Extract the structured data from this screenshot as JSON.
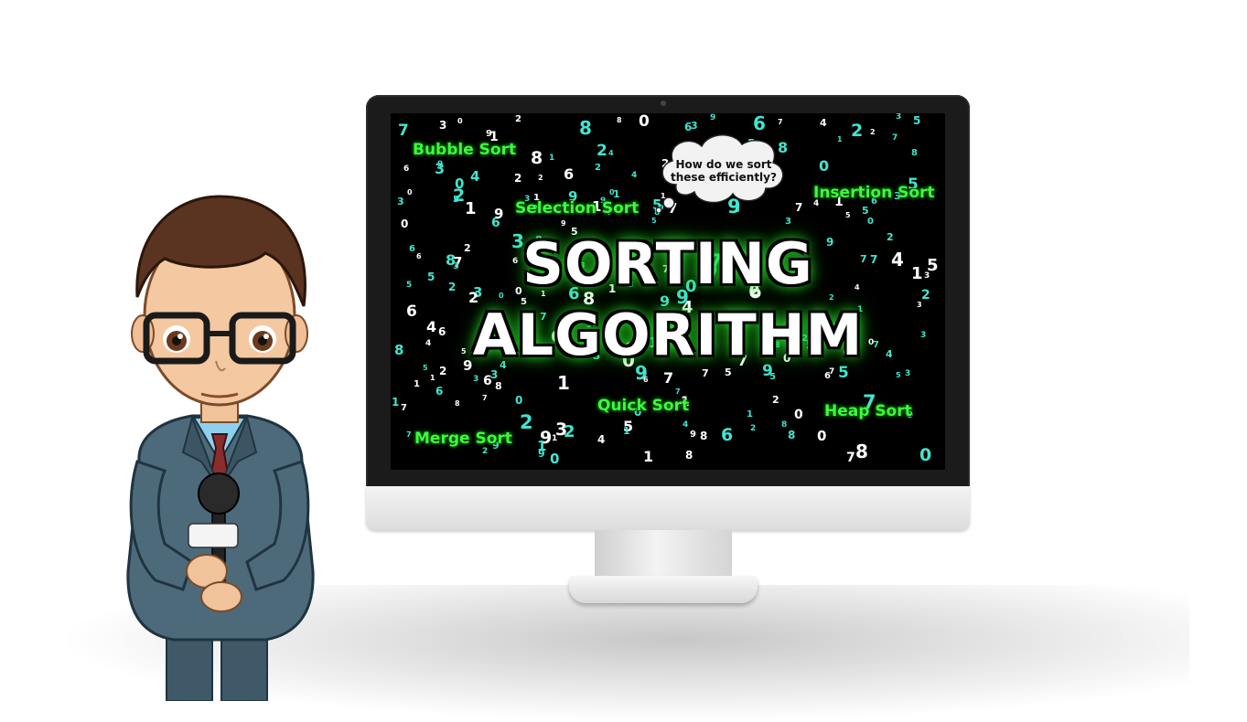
{
  "screen": {
    "title_line1": "SORTING",
    "title_line2": "ALGORITHM",
    "thought_bubble": "How do we sort these efficiently?",
    "algorithms": {
      "bubble": "Bubble Sort",
      "selection": "Selection Sort",
      "insertion": "Insertion Sort",
      "quick": "Quick Sort",
      "heap": "Heap Sort",
      "merge": "Merge Sort"
    }
  },
  "colors": {
    "label_green": "#3bff3b",
    "digit_cyan": "#3fe6d0",
    "digit_white": "#ffffff",
    "screen_bg": "#000000"
  },
  "icons": {
    "character": "reporter-with-microphone",
    "device": "desktop-monitor"
  }
}
